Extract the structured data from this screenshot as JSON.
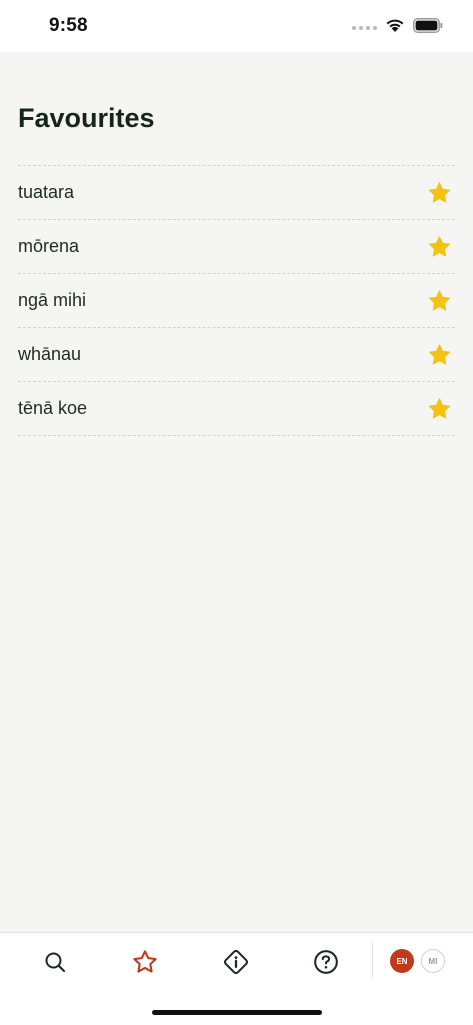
{
  "status_bar": {
    "time": "9:58"
  },
  "page": {
    "title": "Favourites"
  },
  "favourites": [
    {
      "word": "tuatara",
      "starred": true
    },
    {
      "word": "mōrena",
      "starred": true
    },
    {
      "word": "ngā mihi",
      "starred": true
    },
    {
      "word": "whānau",
      "starred": true
    },
    {
      "word": "tēnā koe",
      "starred": true
    }
  ],
  "tab_bar": {
    "tabs": [
      {
        "icon": "search-icon",
        "active": false
      },
      {
        "icon": "star-outline-icon",
        "active": true
      },
      {
        "icon": "info-diamond-icon",
        "active": false
      },
      {
        "icon": "help-circle-icon",
        "active": false
      }
    ],
    "languages": {
      "en_label": "EN",
      "mi_label": "MI",
      "selected": "EN"
    }
  },
  "colors": {
    "accent": "#c2381b",
    "star": "#f5c211",
    "icon_default": "#1d2a24",
    "text": "#1f2b25"
  }
}
